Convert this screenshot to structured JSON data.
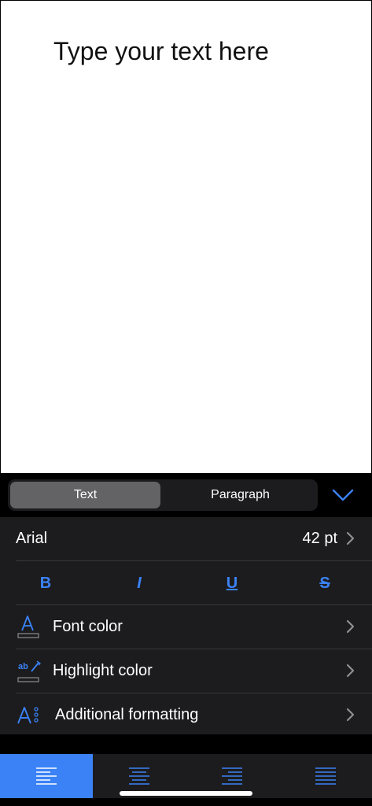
{
  "canvas": {
    "text": "Type your text here"
  },
  "tabs": {
    "text_label": "Text",
    "paragraph_label": "Paragraph",
    "active": "Text"
  },
  "font": {
    "name": "Arial",
    "size": "42 pt"
  },
  "styles": {
    "bold": "B",
    "italic": "I",
    "underline": "U",
    "strikethrough": "S"
  },
  "rows": {
    "font_color": "Font color",
    "highlight_color": "Highlight color",
    "additional_formatting": "Additional formatting"
  },
  "alignment": {
    "active": "left",
    "options": [
      "left",
      "center",
      "right",
      "justify"
    ]
  },
  "colors": {
    "accent": "#3b82f6",
    "panel": "#1c1c1e",
    "segment_active": "#636366"
  },
  "icons": [
    "chevron-down-icon",
    "chevron-right-icon",
    "font-color-icon",
    "highlight-color-icon",
    "additional-formatting-icon",
    "align-left-icon",
    "align-center-icon",
    "align-right-icon",
    "align-justify-icon"
  ]
}
